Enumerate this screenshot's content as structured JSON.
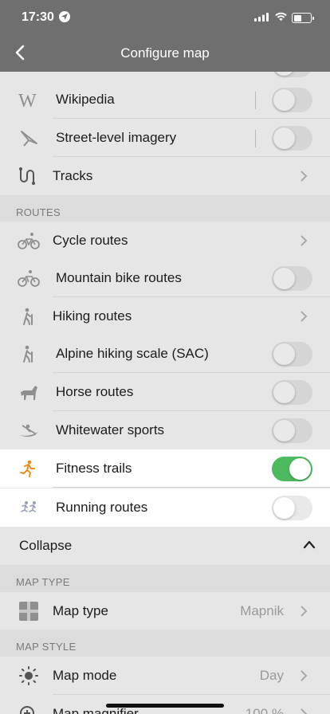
{
  "status": {
    "time": "17:30"
  },
  "nav": {
    "title": "Configure map"
  },
  "rows_top": [
    {
      "label": "Wikipedia",
      "icon": "wikipedia-icon",
      "toggle": false
    },
    {
      "label": "Street-level imagery",
      "icon": "street-level-imagery-icon",
      "toggle": false
    },
    {
      "label": "Tracks",
      "icon": "tracks-icon",
      "chevron": true
    }
  ],
  "section_routes": "ROUTES",
  "routes": [
    {
      "label": "Cycle routes",
      "icon": "bicycle-icon",
      "chevron": true
    },
    {
      "label": "Mountain bike routes",
      "icon": "mountain-bike-icon",
      "toggle": false
    },
    {
      "label": "Hiking routes",
      "icon": "hiker-icon",
      "chevron": true
    },
    {
      "label": "Alpine hiking scale (SAC)",
      "icon": "alpine-hiker-icon",
      "toggle": false
    },
    {
      "label": "Horse routes",
      "icon": "horse-icon",
      "toggle": false
    },
    {
      "label": "Whitewater sports",
      "icon": "kayak-icon",
      "toggle": false
    },
    {
      "label": "Fitness trails",
      "icon": "runner-icon",
      "toggle": true,
      "active_color": "#f08a1a"
    },
    {
      "label": "Running routes",
      "icon": "running-routes-icon",
      "toggle": false
    }
  ],
  "collapse_label": "Collapse",
  "section_map_type": "MAP TYPE",
  "map_type": {
    "label": "Map type",
    "value": "Mapnik",
    "icon": "map-type-icon"
  },
  "section_map_style": "MAP STYLE",
  "map_mode": {
    "label": "Map mode",
    "value": "Day",
    "icon": "sun-icon"
  },
  "map_magnifier": {
    "label": "Map magnifier",
    "value": "100 %",
    "icon": "magnifier-icon"
  },
  "colors": {
    "nav_bg": "#6f6f6f",
    "toggle_on": "#4cbb5f",
    "highlight_bg": "#ffffff"
  }
}
